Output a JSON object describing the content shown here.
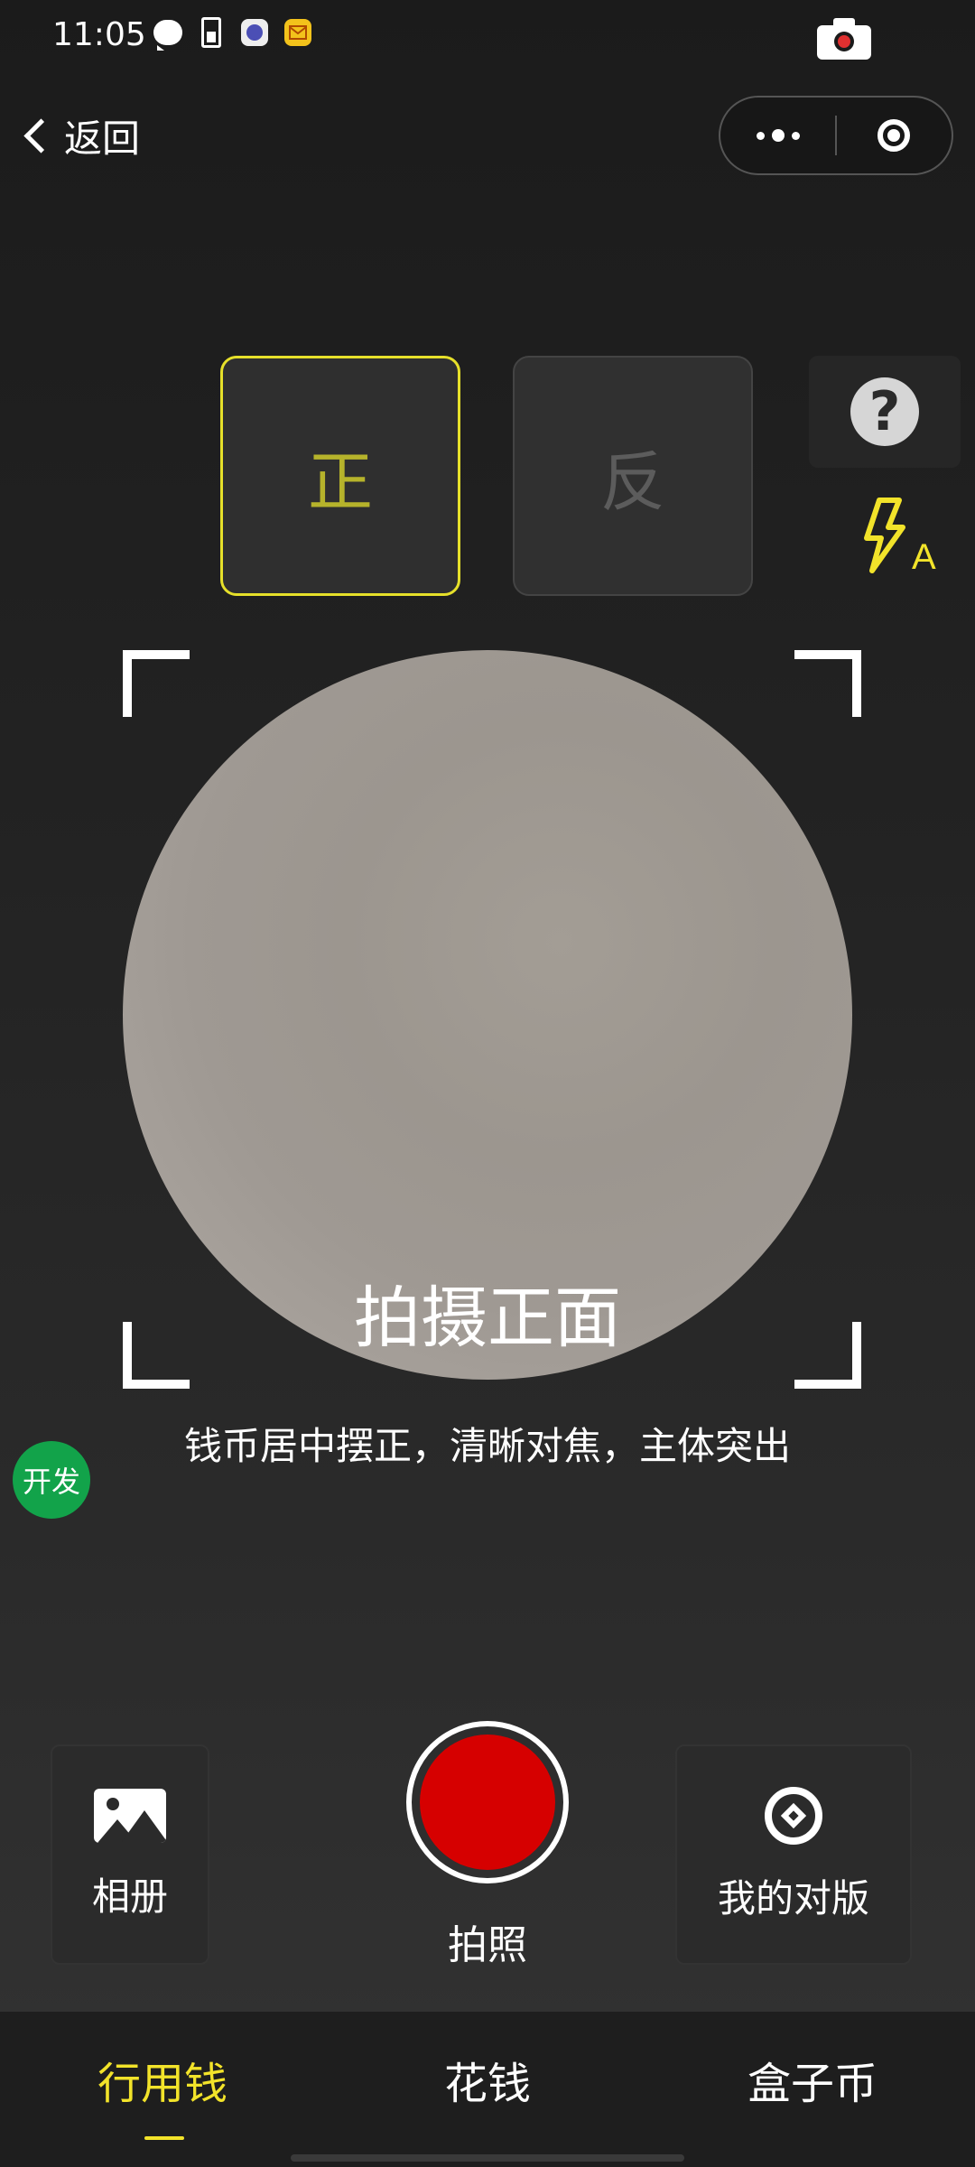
{
  "status_bar": {
    "time": "11:05",
    "icons": [
      "chat-icon",
      "battery-icon",
      "app-icon",
      "mail-icon",
      "camera-icon"
    ]
  },
  "nav": {
    "back_label": "返回",
    "capsule_icons": [
      "more-icon",
      "close-target-icon"
    ]
  },
  "side_selector": {
    "front_label": "正",
    "back_label": "反",
    "active": "正",
    "colors": {
      "active_border": "#e6e02a",
      "active_text": "#b6b32b"
    }
  },
  "tools": {
    "help_icon_text": "?",
    "flash_mode_label": "A"
  },
  "viewfinder": {
    "title": "拍摄正面",
    "hint": "钱币居中摆正，清晰对焦，主体突出"
  },
  "dev_badge": "开发",
  "controls": {
    "album_label": "相册",
    "shutter_label": "拍照",
    "compare_label": "我的对版",
    "shutter_color": "#d60000"
  },
  "tabs": [
    {
      "label": "行用钱",
      "active": true
    },
    {
      "label": "花钱",
      "active": false
    },
    {
      "label": "盒子币",
      "active": false
    }
  ],
  "accent_color": "#f2e32a"
}
